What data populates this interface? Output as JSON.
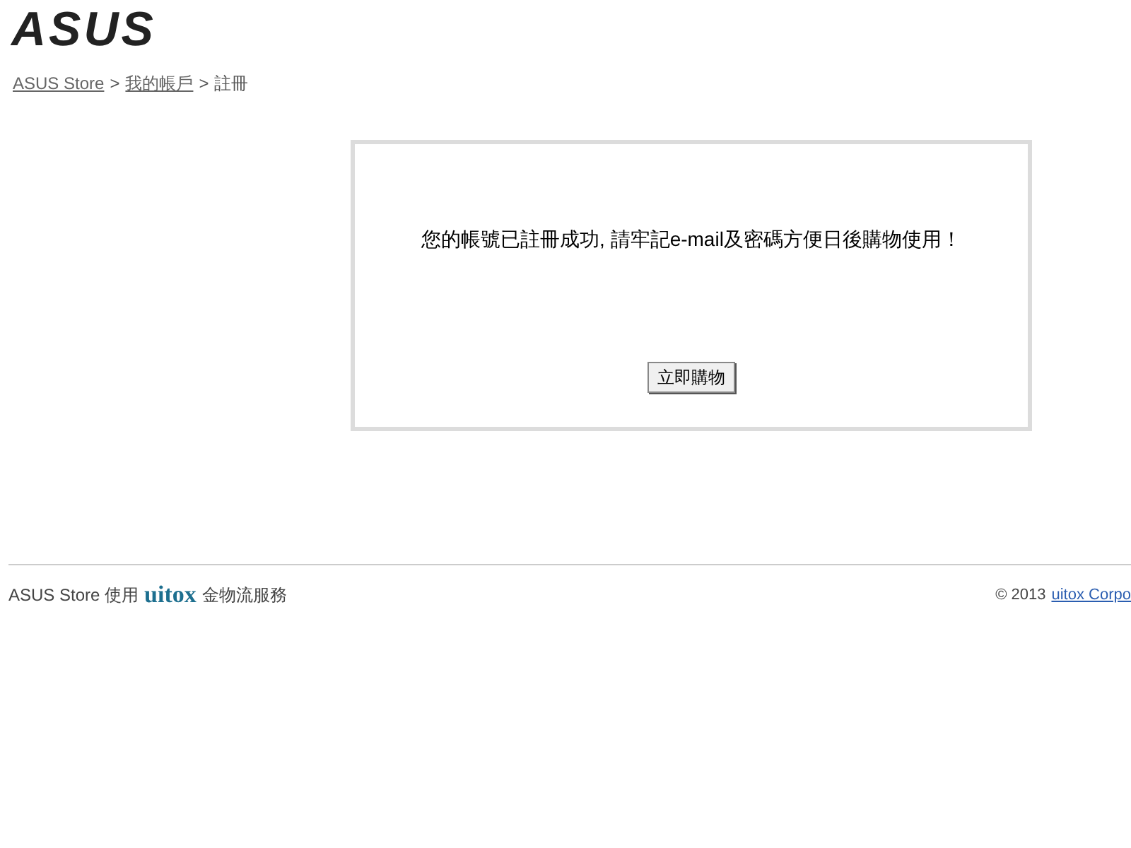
{
  "logo": "ASUS",
  "breadcrumb": [
    {
      "label": "ASUS Store",
      "link": true
    },
    {
      "label": ">",
      "link": false
    },
    {
      "label": "我的帳戶",
      "link": true
    },
    {
      "label": ">",
      "link": false
    },
    {
      "label": "註冊",
      "link": false
    }
  ],
  "message": "您的帳號已註冊成功, 請牢記e-mail及密碼方便日後購物使用！",
  "button": "立即購物",
  "footer": {
    "left_prefix": "ASUS Store 使用",
    "brand": "uitox",
    "left_suffix": "金物流服務",
    "copyright": "© 2013",
    "link": "uitox Corpo"
  }
}
